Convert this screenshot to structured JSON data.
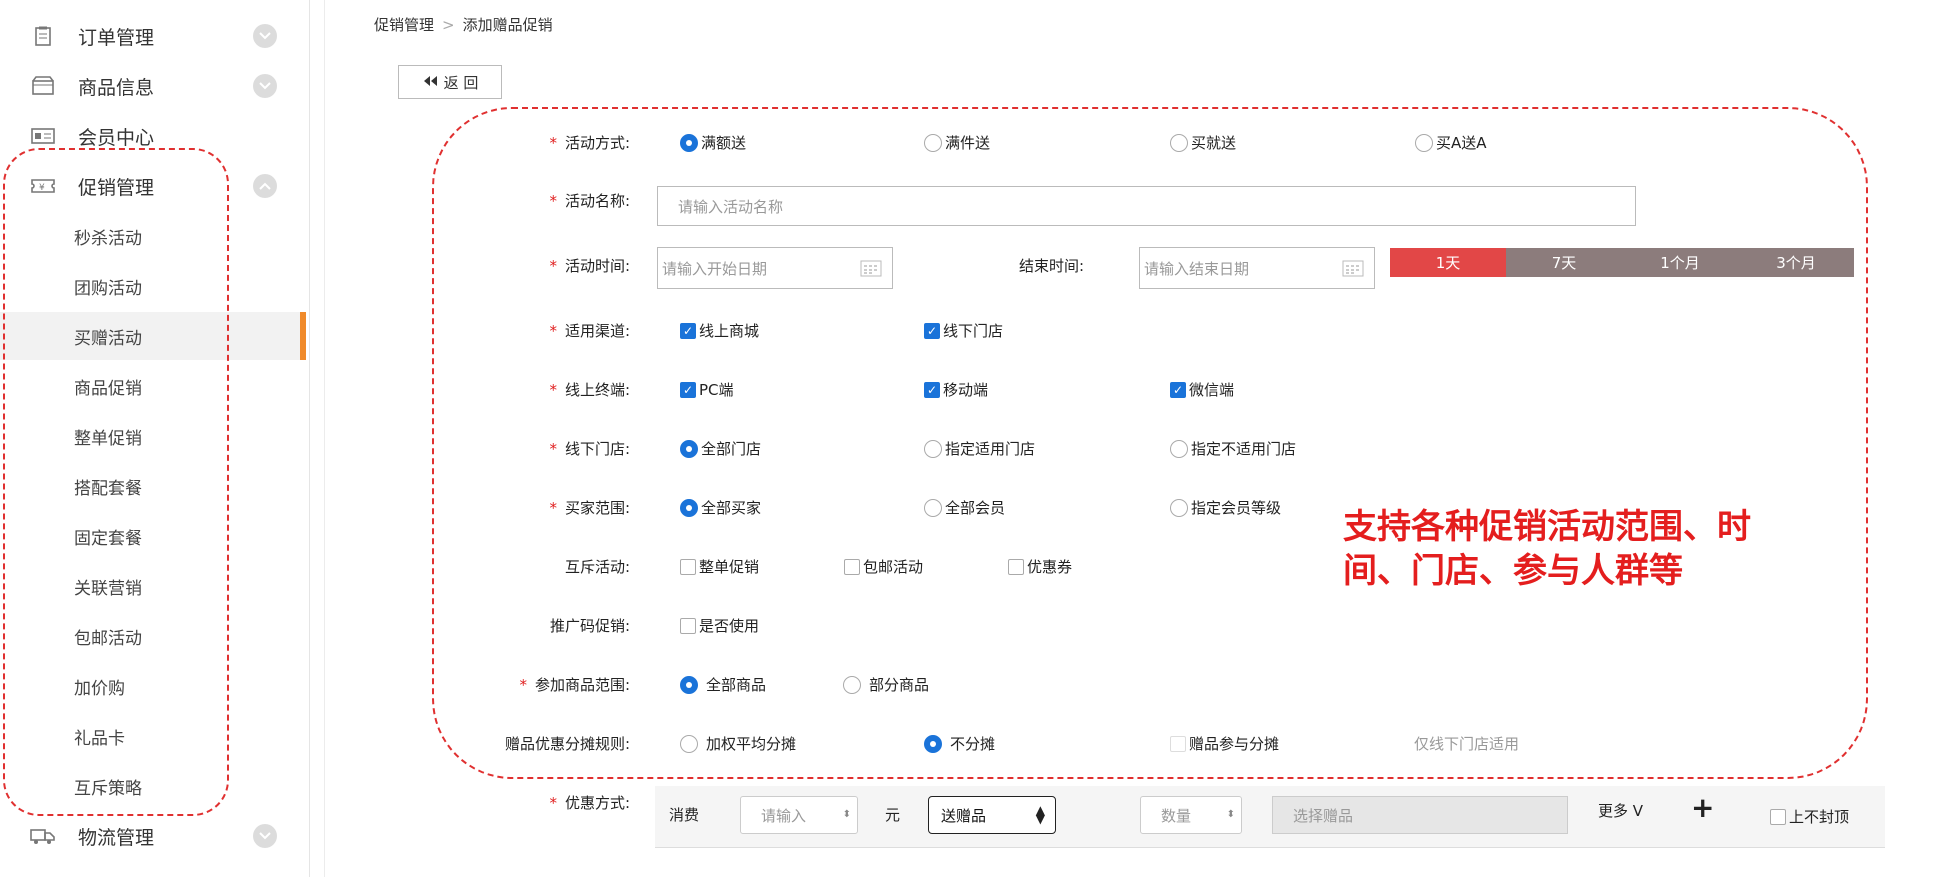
{
  "sidebar": {
    "menus": [
      {
        "label": "订单管理",
        "icon": "clipboard-icon",
        "expanded": false
      },
      {
        "label": "商品信息",
        "icon": "box-icon",
        "expanded": false
      },
      {
        "label": "会员中心",
        "icon": "member-card-icon"
      },
      {
        "label": "促销管理",
        "icon": "ticket-icon",
        "expanded": true
      }
    ],
    "promo_items": [
      "秒杀活动",
      "团购活动",
      "买赠活动",
      "商品促销",
      "整单促销",
      "搭配套餐",
      "固定套餐",
      "关联营销",
      "包邮活动",
      "加价购",
      "礼品卡",
      "互斥策略"
    ],
    "active_item": "买赠活动",
    "logistics": {
      "label": "物流管理",
      "icon": "truck-icon",
      "expanded": false
    }
  },
  "breadcrumb": {
    "parent": "促销管理",
    "separator": ">",
    "current": "添加赠品促销"
  },
  "back_button": "返 回",
  "form": {
    "activity_type": {
      "label": "活动方式:",
      "options": [
        "满额送",
        "满件送",
        "买就送",
        "买A送A"
      ],
      "selected": "满额送"
    },
    "activity_name": {
      "label": "活动名称:",
      "placeholder": "请输入活动名称"
    },
    "activity_time": {
      "label": "活动时间:",
      "start_placeholder": "请输入开始日期",
      "end_label": "结束时间:",
      "end_placeholder": "请输入结束日期",
      "ranges": [
        "1天",
        "7天",
        "1个月",
        "3个月"
      ],
      "selected_range": "1天"
    },
    "channel": {
      "label": "适用渠道:",
      "options": [
        "线上商城",
        "线下门店"
      ],
      "checked": [
        true,
        true
      ]
    },
    "online_terminal": {
      "label": "线上终端:",
      "options": [
        "PC端",
        "移动端",
        "微信端"
      ],
      "checked": [
        true,
        true,
        true
      ]
    },
    "offline_store": {
      "label": "线下门店:",
      "options": [
        "全部门店",
        "指定适用门店",
        "指定不适用门店"
      ],
      "selected": "全部门店"
    },
    "buyer_scope": {
      "label": "买家范围:",
      "options": [
        "全部买家",
        "全部会员",
        "指定会员等级"
      ],
      "selected": "全部买家"
    },
    "exclusive": {
      "label": "互斥活动:",
      "options": [
        "整单促销",
        "包邮活动",
        "优惠券"
      ],
      "checked": [
        false,
        false,
        false
      ]
    },
    "promo_code": {
      "label": "推广码促销:",
      "options": [
        "是否使用"
      ],
      "checked": [
        false
      ]
    },
    "product_scope": {
      "label": "参加商品范围:",
      "options": [
        "全部商品",
        "部分商品"
      ],
      "selected": "全部商品"
    },
    "gift_share": {
      "label": "赠品优惠分摊规则:",
      "options": [
        "加权平均分摊",
        "不分摊"
      ],
      "selected": "不分摊",
      "check_option": "赠品参与分摊",
      "note": "仅线下门店适用"
    },
    "discount": {
      "label": "优惠方式:",
      "consume": "消费",
      "amount_placeholder": "请输入",
      "unit": "元",
      "gift_select": "送赠品",
      "qty_placeholder": "数量",
      "choose_placeholder": "选择赠品",
      "more": "更多 V",
      "plus": "+",
      "no_cap": "上不封顶"
    }
  },
  "annotation": "支持各种促销活动范围、时间、门店、参与人群等",
  "colors": {
    "accent": "#1a73d9",
    "required": "#e02020",
    "range_selected": "#e24747",
    "range_default": "#8c7c7c",
    "active_bar": "#f08a2a",
    "annotation": "#e41e1e"
  }
}
